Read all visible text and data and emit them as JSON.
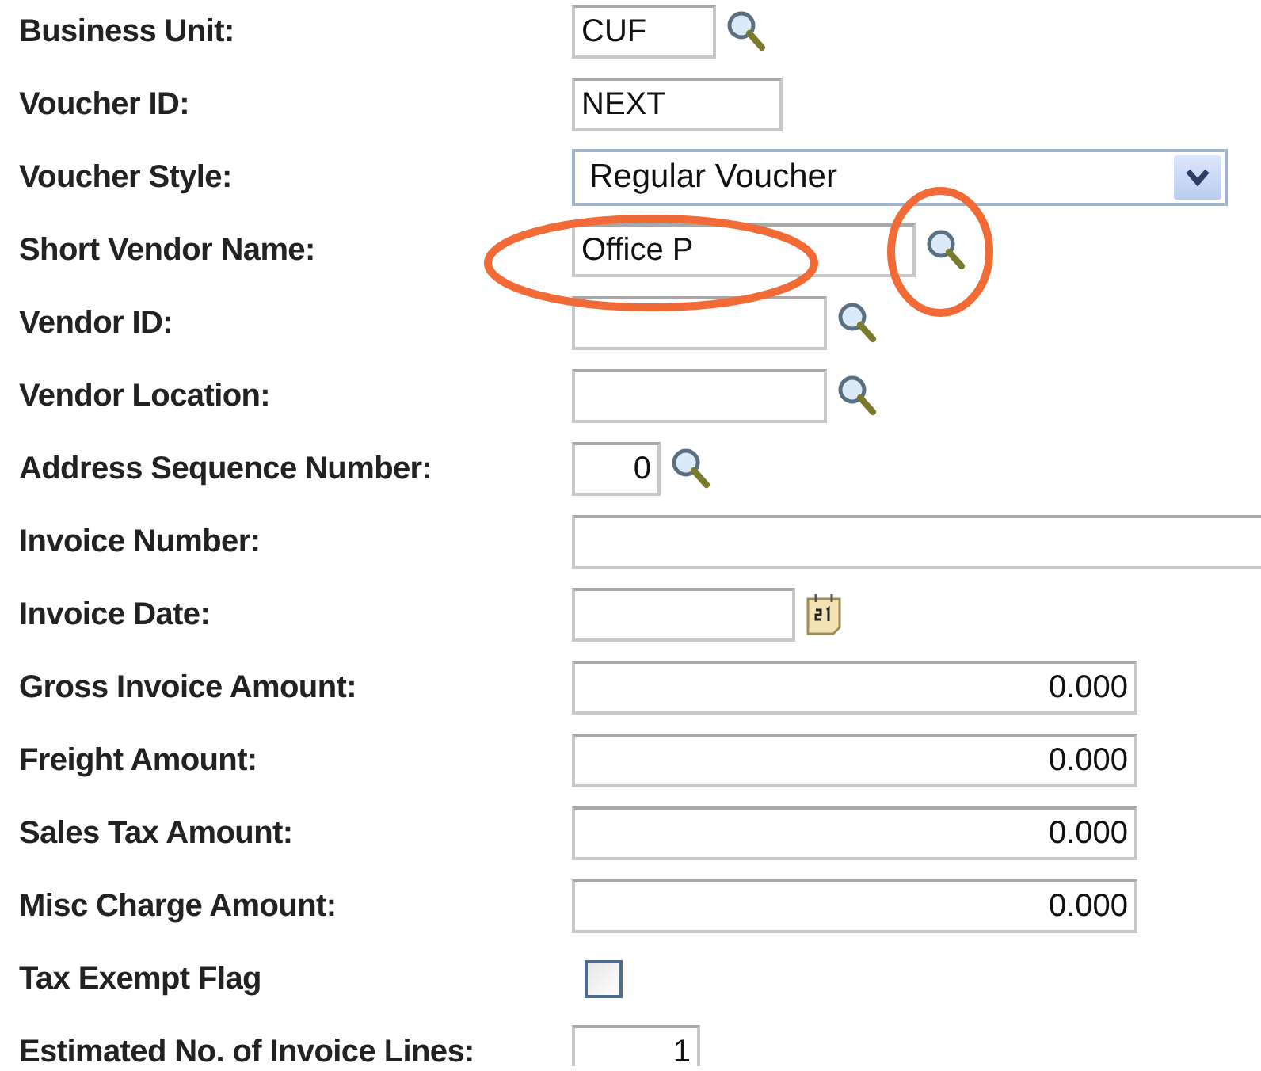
{
  "form": {
    "rows": [
      {
        "label": "Business Unit:",
        "kind": "code",
        "value": "CUF",
        "field_circled": false,
        "lookup_circled": false
      },
      {
        "label": "Voucher ID:",
        "kind": "text",
        "value": "NEXT",
        "field_circled": false,
        "lookup_circled": false
      },
      {
        "label": "Voucher Style:",
        "kind": "select",
        "value": "Regular Voucher",
        "field_circled": false,
        "lookup_circled": false
      },
      {
        "label": "Short Vendor Name:",
        "kind": "name_lookup",
        "value": "Office P",
        "field_circled": true,
        "lookup_circled": true
      },
      {
        "label": "Vendor ID:",
        "kind": "lookup",
        "field_circled": false,
        "lookup_circled": false
      },
      {
        "label": "Vendor Location:",
        "kind": "lookup",
        "field_circled": false,
        "lookup_circled": false
      },
      {
        "label": "Address Sequence Number:",
        "kind": "seq",
        "value": "0",
        "field_circled": false,
        "lookup_circled": false
      },
      {
        "label": "Invoice Number:",
        "kind": "wide",
        "field_circled": false,
        "lookup_circled": false
      },
      {
        "label": "Invoice Date:",
        "kind": "date",
        "field_circled": false,
        "lookup_circled": false
      },
      {
        "label": "Gross Invoice Amount:",
        "kind": "amount",
        "value": "0.000",
        "field_circled": false,
        "lookup_circled": false
      },
      {
        "label": "Freight Amount:",
        "kind": "amount",
        "value": "0.000",
        "field_circled": false,
        "lookup_circled": false
      },
      {
        "label": "Sales Tax Amount:",
        "kind": "amount",
        "value": "0.000",
        "field_circled": false,
        "lookup_circled": false
      },
      {
        "label": "Misc Charge Amount:",
        "kind": "amount",
        "value": "0.000",
        "field_circled": false,
        "lookup_circled": false
      },
      {
        "label": "Tax Exempt Flag",
        "kind": "checkbox",
        "checked": false,
        "field_circled": false,
        "lookup_circled": false
      },
      {
        "label": "Estimated No. of Invoice Lines:",
        "kind": "count",
        "value": "1",
        "field_circled": false,
        "lookup_circled": false
      }
    ]
  }
}
